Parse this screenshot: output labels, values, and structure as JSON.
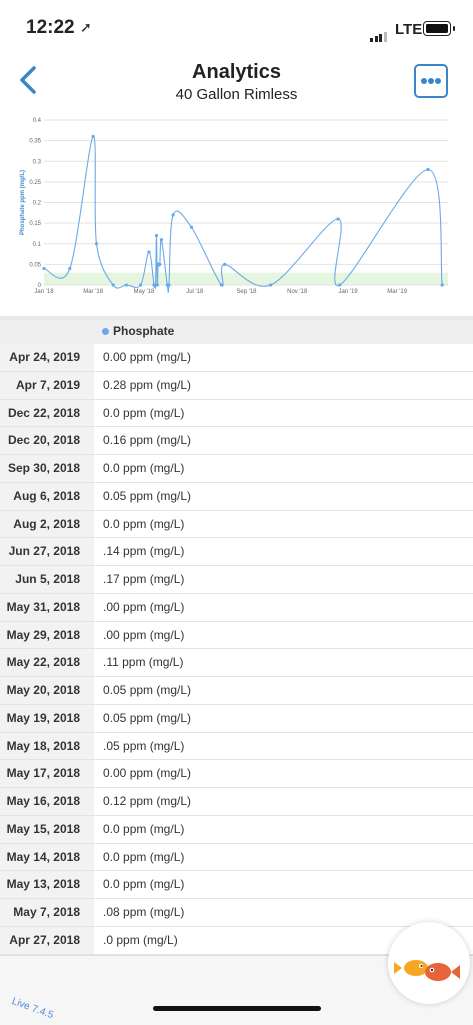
{
  "status_bar": {
    "time": "12:22",
    "network": "LTE"
  },
  "nav": {
    "title": "Analytics",
    "subtitle": "40 Gallon Rimless"
  },
  "chart_data": {
    "type": "line",
    "ylabel": "Phosphate ppm (mg/L)",
    "ylim": [
      0,
      0.4
    ],
    "yticks": [
      "0",
      "0.05",
      "0.1",
      "0.15",
      "0.2",
      "0.25",
      "0.3",
      "0.35",
      "0.4"
    ],
    "xticks": [
      "Jan '18",
      "Mar '18",
      "May '18",
      "Jul '18",
      "Sep '18",
      "Nov '18",
      "Jan '19",
      "Mar '19"
    ],
    "target_band": [
      0,
      0.03
    ],
    "series": [
      {
        "color": "#6aa9e9",
        "points": [
          {
            "x": "2018-01-01",
            "y": 0.04
          },
          {
            "x": "2018-02-01",
            "y": 0.04
          },
          {
            "x": "2018-03-01",
            "y": 0.36
          },
          {
            "x": "2018-03-05",
            "y": 0.1
          },
          {
            "x": "2018-03-25",
            "y": 0.0
          },
          {
            "x": "2018-04-10",
            "y": 0.0
          },
          {
            "x": "2018-04-27",
            "y": 0.0
          },
          {
            "x": "2018-05-07",
            "y": 0.08
          },
          {
            "x": "2018-05-13",
            "y": 0.0
          },
          {
            "x": "2018-05-14",
            "y": 0.0
          },
          {
            "x": "2018-05-15",
            "y": 0.0
          },
          {
            "x": "2018-05-16",
            "y": 0.12
          },
          {
            "x": "2018-05-17",
            "y": 0.0
          },
          {
            "x": "2018-05-18",
            "y": 0.05
          },
          {
            "x": "2018-05-19",
            "y": 0.05
          },
          {
            "x": "2018-05-20",
            "y": 0.05
          },
          {
            "x": "2018-05-22",
            "y": 0.11
          },
          {
            "x": "2018-05-29",
            "y": 0.0
          },
          {
            "x": "2018-05-31",
            "y": 0.0
          },
          {
            "x": "2018-06-05",
            "y": 0.17
          },
          {
            "x": "2018-06-27",
            "y": 0.14
          },
          {
            "x": "2018-08-02",
            "y": 0.0
          },
          {
            "x": "2018-08-06",
            "y": 0.05
          },
          {
            "x": "2018-09-30",
            "y": 0.0
          },
          {
            "x": "2018-12-20",
            "y": 0.16
          },
          {
            "x": "2018-12-22",
            "y": 0.0
          },
          {
            "x": "2019-04-07",
            "y": 0.28
          },
          {
            "x": "2019-04-24",
            "y": 0.0
          }
        ]
      }
    ]
  },
  "table": {
    "column_label": "Phosphate",
    "rows": [
      {
        "date": "Apr 24, 2019",
        "value": "0.00 ppm (mg/L)"
      },
      {
        "date": "Apr 7, 2019",
        "value": "0.28 ppm (mg/L)"
      },
      {
        "date": "Dec 22, 2018",
        "value": "0.0 ppm (mg/L)"
      },
      {
        "date": "Dec 20, 2018",
        "value": "0.16 ppm (mg/L)"
      },
      {
        "date": "Sep 30, 2018",
        "value": "0.0 ppm (mg/L)"
      },
      {
        "date": "Aug 6, 2018",
        "value": "0.05 ppm (mg/L)"
      },
      {
        "date": "Aug 2, 2018",
        "value": "0.0 ppm (mg/L)"
      },
      {
        "date": "Jun 27, 2018",
        "value": ".14 ppm (mg/L)"
      },
      {
        "date": "Jun 5, 2018",
        "value": ".17 ppm (mg/L)"
      },
      {
        "date": "May 31, 2018",
        "value": ".00 ppm (mg/L)"
      },
      {
        "date": "May 29, 2018",
        "value": ".00 ppm (mg/L)"
      },
      {
        "date": "May 22, 2018",
        "value": ".11 ppm (mg/L)"
      },
      {
        "date": "May 20, 2018",
        "value": "0.05 ppm (mg/L)"
      },
      {
        "date": "May 19, 2018",
        "value": "0.05 ppm (mg/L)"
      },
      {
        "date": "May 18, 2018",
        "value": ".05 ppm (mg/L)"
      },
      {
        "date": "May 17, 2018",
        "value": "0.00 ppm (mg/L)"
      },
      {
        "date": "May 16, 2018",
        "value": "0.12 ppm (mg/L)"
      },
      {
        "date": "May 15, 2018",
        "value": "0.0 ppm (mg/L)"
      },
      {
        "date": "May 14, 2018",
        "value": "0.0 ppm (mg/L)"
      },
      {
        "date": "May 13, 2018",
        "value": "0.0 ppm (mg/L)"
      },
      {
        "date": "May 7, 2018",
        "value": ".08 ppm (mg/L)"
      },
      {
        "date": "Apr 27, 2018",
        "value": ".0 ppm (mg/L)"
      }
    ]
  },
  "footer": {
    "version": "Live 7.4.5"
  },
  "icons": {
    "back": "chevron-left-icon",
    "menu": "more-icon",
    "fab": "fish-logo-icon"
  },
  "colors": {
    "accent": "#3a86c7",
    "series": "#6aa9e9",
    "band": "#e6f5e0"
  }
}
